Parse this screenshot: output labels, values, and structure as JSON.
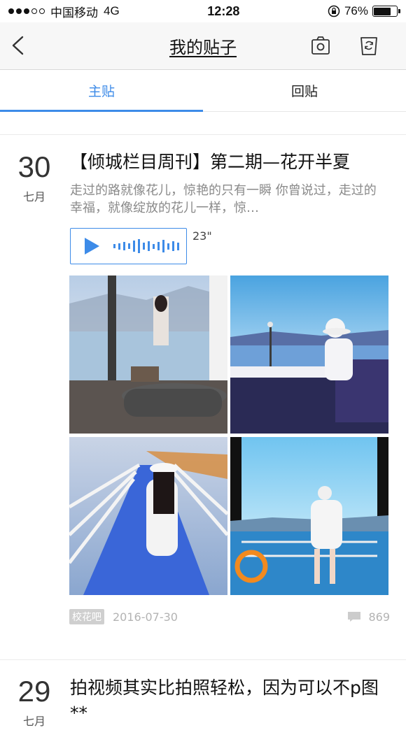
{
  "status_bar": {
    "carrier": "中国移动",
    "network": "4G",
    "time": "12:28",
    "battery": "76%",
    "battery_level": 0.76
  },
  "nav": {
    "title": "我的贴子",
    "icons": [
      "back-icon",
      "camera-icon",
      "trash-icon"
    ]
  },
  "tabs": [
    {
      "label": "主贴",
      "active": true
    },
    {
      "label": "回贴",
      "active": false
    }
  ],
  "posts": [
    {
      "day": "30",
      "month": "七月",
      "title": "【倾城栏目周刊】第二期—花开半夏",
      "body": "走过的路就像花儿，惊艳的只有一瞬 你曾说过，走过的幸福，就像绽放的花儿一样，惊…",
      "voice_duration": "23\"",
      "tag": "校花吧",
      "date": "2016-07-30",
      "comments": "869"
    },
    {
      "day": "29",
      "month": "七月",
      "title": "拍视频其实比拍照轻松，因为可以不p图**"
    }
  ],
  "colors": {
    "accent": "#3d8be8",
    "text_gray": "#8a8a8a",
    "meta_gray": "#b3b3b3"
  }
}
